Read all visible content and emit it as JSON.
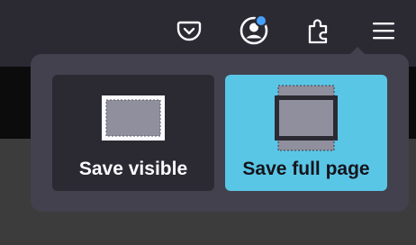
{
  "toolbar": {
    "buttons": [
      {
        "name": "pocket",
        "icon": "pocket-icon"
      },
      {
        "name": "account",
        "icon": "account-icon",
        "badge_color": "#45a1ff"
      },
      {
        "name": "extensions",
        "icon": "puzzle-piece-icon"
      },
      {
        "name": "menu",
        "icon": "hamburger-menu-icon"
      }
    ]
  },
  "screenshot_panel": {
    "options": [
      {
        "label": "Save visible",
        "icon": "save-visible-icon",
        "selected": false
      },
      {
        "label": "Save full page",
        "icon": "save-full-page-icon",
        "selected": true
      }
    ]
  },
  "colors": {
    "toolbar_bg": "#2b2a33",
    "panel_bg": "#42414d",
    "selected_accent": "#5ac6e6"
  }
}
